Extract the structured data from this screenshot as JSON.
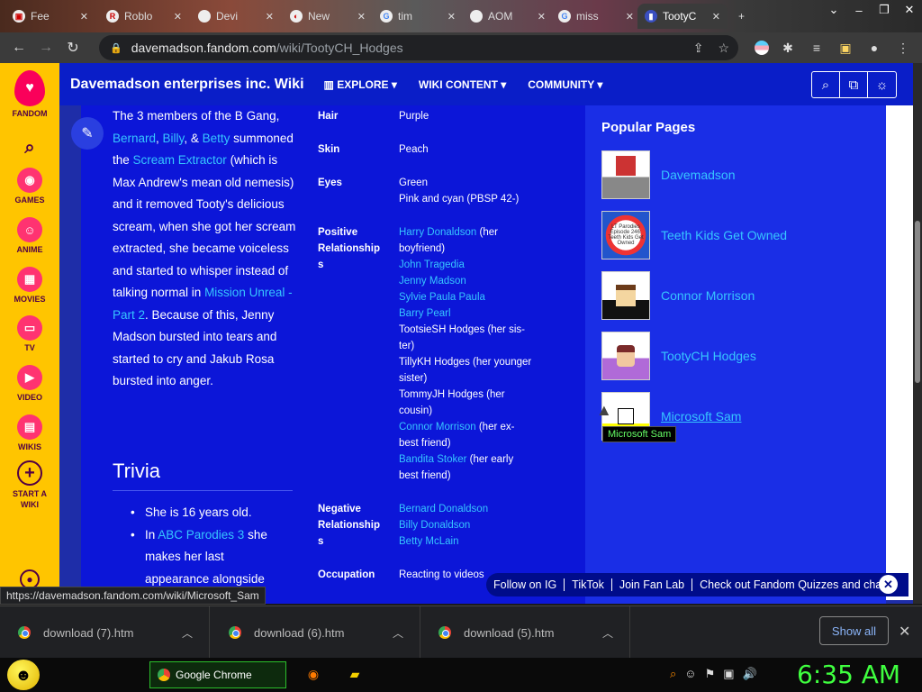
{
  "browser": {
    "tabs": [
      {
        "label": "Fee",
        "active": false
      },
      {
        "label": "Roblo",
        "active": false
      },
      {
        "label": "Devi",
        "active": false
      },
      {
        "label": "New",
        "active": false
      },
      {
        "label": "tim",
        "active": false
      },
      {
        "label": "AOM",
        "active": false
      },
      {
        "label": "miss",
        "active": false
      },
      {
        "label": "TootyC",
        "active": true
      }
    ],
    "new_tab": "+",
    "url_domain": "davemadson.fandom.com",
    "url_path": "/wiki/TootyCH_Hodges"
  },
  "fandom_rail": {
    "brand": "FANDOM",
    "items": [
      {
        "label": "GAMES",
        "icon": "gamepad-icon"
      },
      {
        "label": "ANIME",
        "icon": "anime-icon"
      },
      {
        "label": "MOVIES",
        "icon": "movies-icon"
      },
      {
        "label": "TV",
        "icon": "tv-icon"
      },
      {
        "label": "VIDEO",
        "icon": "video-icon"
      },
      {
        "label": "WIKIS",
        "icon": "wikis-icon"
      },
      {
        "label": "START A WIKI",
        "icon": "plus-circle-icon"
      }
    ]
  },
  "header": {
    "wiki_name": "Davemadson enterprises inc. Wiki",
    "explore": "EXPLORE",
    "wiki_content": "WIKI CONTENT",
    "community": "COMMUNITY"
  },
  "article": {
    "p1": "The 3 members of the B Gang,",
    "l_bernard": "Bernard",
    "s1": ", ",
    "l_billy": "Billy",
    "s2": ", & ",
    "l_betty": "Betty",
    "p2": " summoned the ",
    "l_scream": "Scream Extractor",
    "p3": " (which is Max Andrew's mean old nemesis) and it removed Tooty's delicious scream, when she got her scream extracted, she became voiceless and started to whisper instead of talking normal in ",
    "l_mission": "Mission Unreal - Part 2",
    "p4": ". Because of this, Jenny Madson bursted into tears and started to cry and Jakub Rosa bursted into anger.",
    "trivia_heading": "Trivia",
    "trivia_1": "She is 16 years old.",
    "trivia_2a": "In ",
    "trivia_2_link": "ABC Parodies 3",
    "trivia_2b": " she makes her last appearance alongside"
  },
  "infobox": {
    "hair_label": "Hair",
    "hair": "Purple",
    "skin_label": "Skin",
    "skin": "Peach",
    "eyes_label": "Eyes",
    "eyes_1": "Green",
    "eyes_2": "Pink and cyan (PBSP 42-)",
    "pos_label_1": "Positive",
    "pos_label_2": "Relationship",
    "pos_label_3": "s",
    "pos_1_link": "Harry Donaldson",
    "pos_1_note": " (her",
    "pos_1_note2": "boyfriend)",
    "pos_2": "John Tragedia",
    "pos_3": "Jenny Madson",
    "pos_4": "Sylvie Paula Paula",
    "pos_5": "Barry Pearl",
    "pos_6a": "TootsieSH Hodges (her sis-",
    "pos_6b": "ter)",
    "pos_7a": "TillyKH Hodges (her younger",
    "pos_7b": "sister)",
    "pos_8a": "TommyJH Hodges (her",
    "pos_8b": "cousin)",
    "pos_9_link": "Connor Morrison",
    "pos_9_note": " (her ex-",
    "pos_9_note2": "best friend)",
    "pos_10_link": "Bandita Stoker",
    "pos_10_note": " (her early",
    "pos_10_note2": "best friend)",
    "neg_label_1": "Negative",
    "neg_label_2": "Relationship",
    "neg_label_3": "s",
    "neg_1": "Bernard Donaldson",
    "neg_2": "Billy Donaldson",
    "neg_3": "Betty McLain",
    "occ_label": "Occupation",
    "occ": "Reacting to videos"
  },
  "popular": {
    "title": "Popular Pages",
    "items": [
      {
        "label": "Davemadson",
        "thumb": ""
      },
      {
        "label": "Teeth Kids Get Owned",
        "thumb": "LT Parodies Episode 246: Teeth Kids Get Owned"
      },
      {
        "label": "Connor Morrison",
        "thumb": ""
      },
      {
        "label": "TootyCH Hodges",
        "thumb": ""
      },
      {
        "label": "Microsoft Sam",
        "thumb": ""
      }
    ],
    "tooltip": "Microsoft Sam"
  },
  "follow_bar": {
    "ig": "Follow on IG",
    "tiktok": "TikTok",
    "fanlab": "Join Fan Lab",
    "quizzes": "Check out Fandom Quizzes and cha"
  },
  "status_url": "https://davemadson.fandom.com/wiki/Microsoft_Sam",
  "downloads": {
    "items": [
      "download (7).htm",
      "download (6).htm",
      "download (5).htm"
    ],
    "show_all": "Show all"
  },
  "taskbar": {
    "chrome_label": "Google Chrome",
    "clock": "6:35 AM"
  },
  "colors": {
    "accent_blue": "#0c16d8",
    "link": "#36c6ff",
    "fandom_yellow": "#ffc500",
    "clock_green": "#3fff3f"
  }
}
